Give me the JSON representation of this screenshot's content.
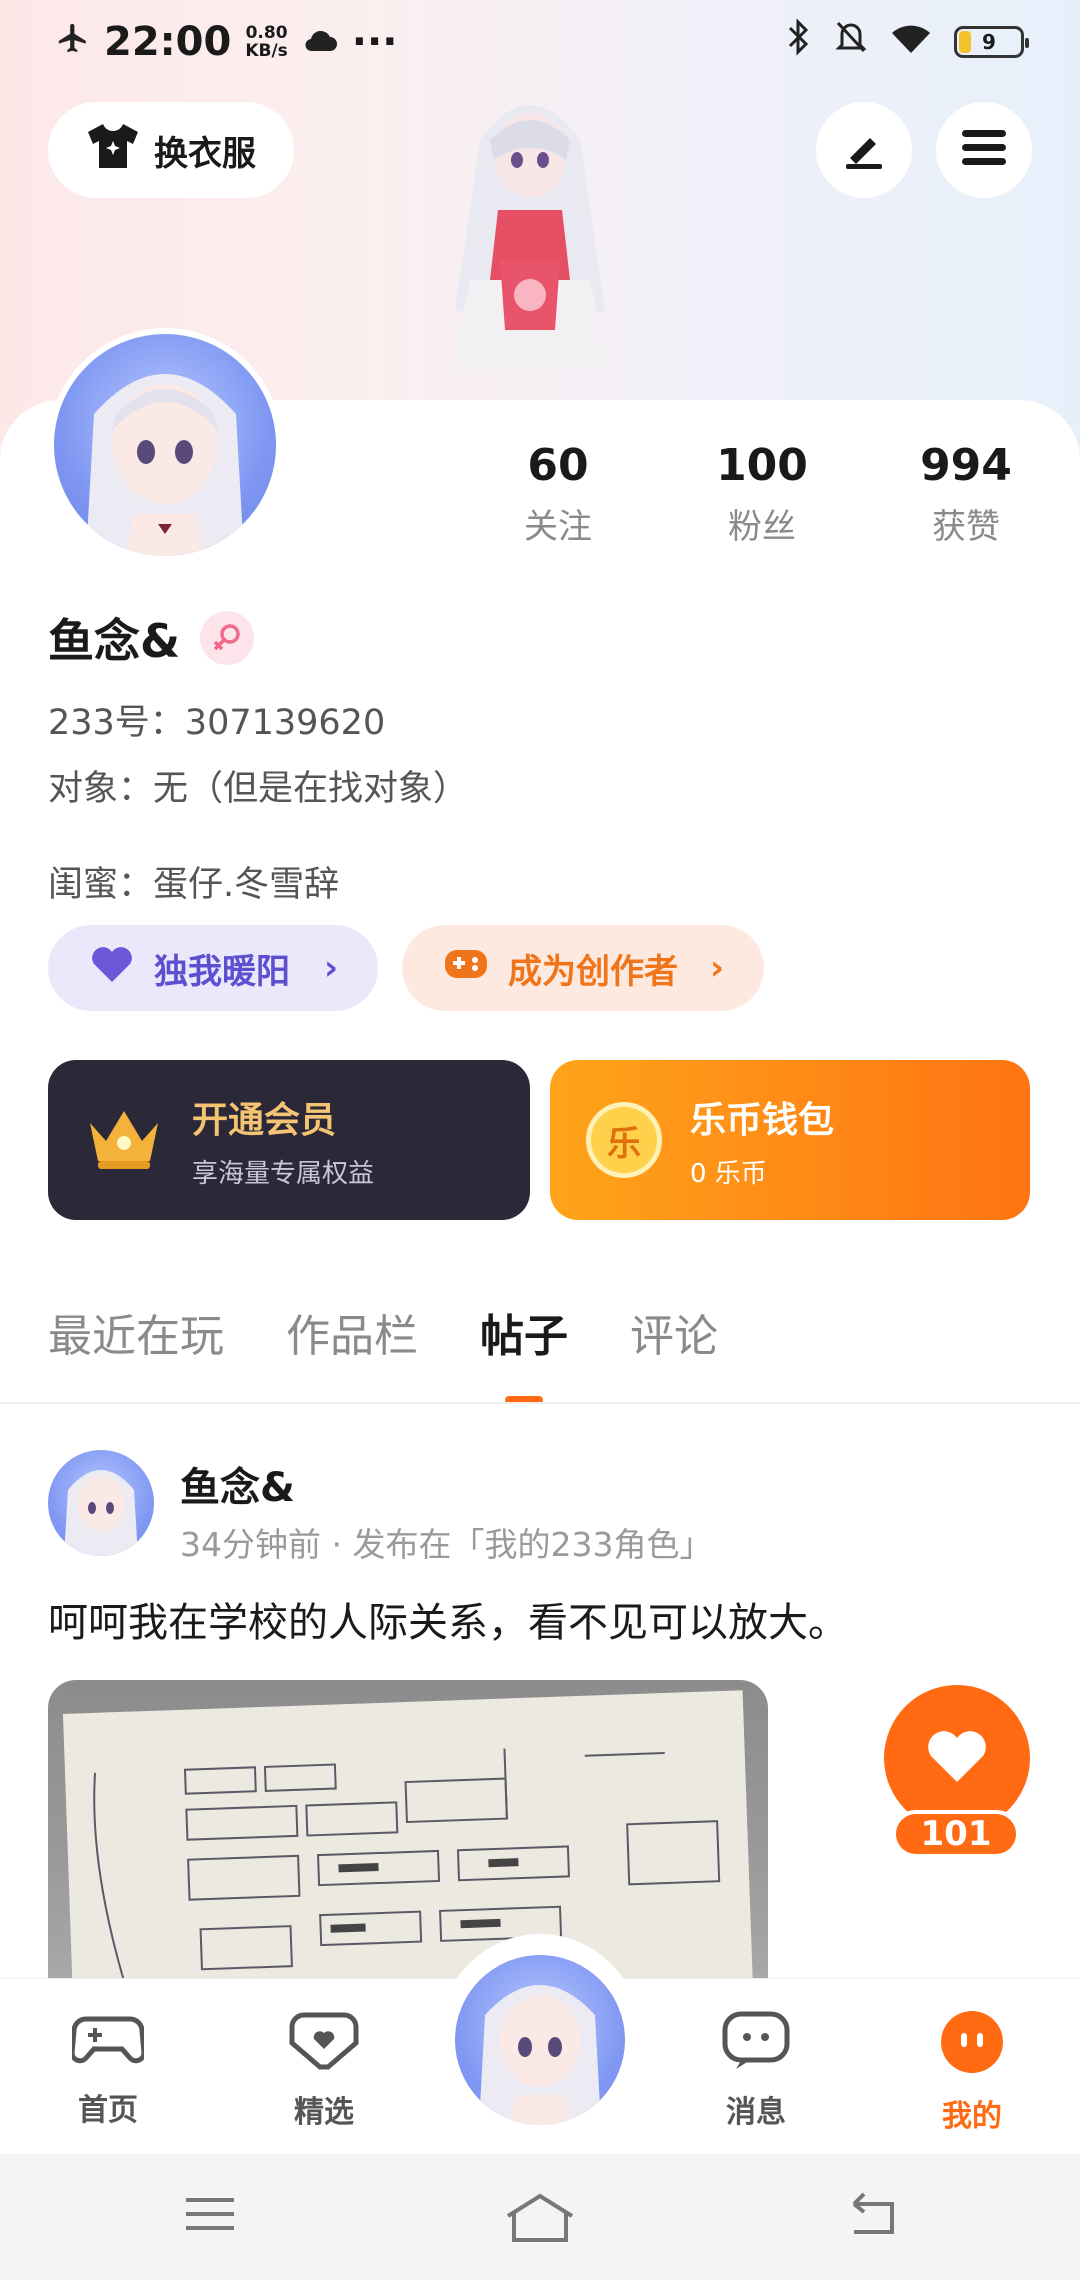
{
  "status_bar": {
    "time": "22:00",
    "speed_value": "0.80",
    "speed_unit": "KB/s",
    "more": "···",
    "battery": "9"
  },
  "header": {
    "outfit_label": "换衣服"
  },
  "stats": [
    {
      "value": "60",
      "label": "关注"
    },
    {
      "value": "100",
      "label": "粉丝"
    },
    {
      "value": "994",
      "label": "获赞"
    }
  ],
  "profile": {
    "name": "鱼念&",
    "id_line": "233号：307139620",
    "partner_line": "对象：无（但是在找对象）",
    "bestie_line": "闺蜜：蛋仔.冬雪辞"
  },
  "pills": {
    "left_label": "独我暖阳",
    "right_label": "成为创作者"
  },
  "member": {
    "title": "开通会员",
    "subtitle": "享海量专属权益"
  },
  "wallet": {
    "icon_char": "乐",
    "title": "乐币钱包",
    "subtitle": "0 乐币"
  },
  "tabs": [
    "最近在玩",
    "作品栏",
    "帖子",
    "评论"
  ],
  "post": {
    "author": "鱼念&",
    "meta": "34分钟前 · 发布在「我的233角色」",
    "text": "呵呵我在学校的人际关系，看不见可以放大。",
    "likes": "101"
  },
  "bottom_nav": [
    "首页",
    "精选",
    "消息",
    "我的"
  ],
  "colors": {
    "accent": "#ff6a13",
    "purple": "#5d4fcf",
    "member_bg": "#2b2838"
  }
}
